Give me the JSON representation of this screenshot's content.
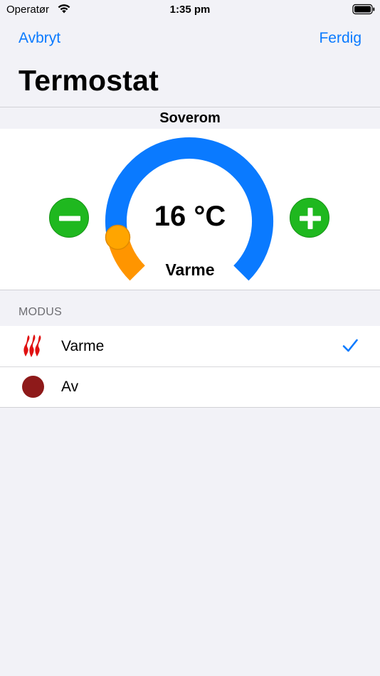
{
  "status_bar": {
    "carrier": "Operatør",
    "time": "1:35 pm"
  },
  "nav": {
    "cancel_label": "Avbryt",
    "done_label": "Ferdig"
  },
  "page_title": "Termostat",
  "room_name": "Soverom",
  "thermostat": {
    "temperature": "16 °C",
    "mode": "Varme",
    "dial_level": 0.12
  },
  "section_header": "MODUS",
  "modes": [
    {
      "label": "Varme",
      "icon": "flame-icon",
      "selected": true
    },
    {
      "label": "Av",
      "icon": "off-dot-icon",
      "selected": false
    }
  ],
  "colors": {
    "accent": "#0a7aff",
    "heat_arc": "#ff9500",
    "cool_arc": "#0a7aff",
    "knob": "#ffa500",
    "button": "#1fb81f",
    "off_dot": "#8e1a1a",
    "flame": "#e01010"
  }
}
